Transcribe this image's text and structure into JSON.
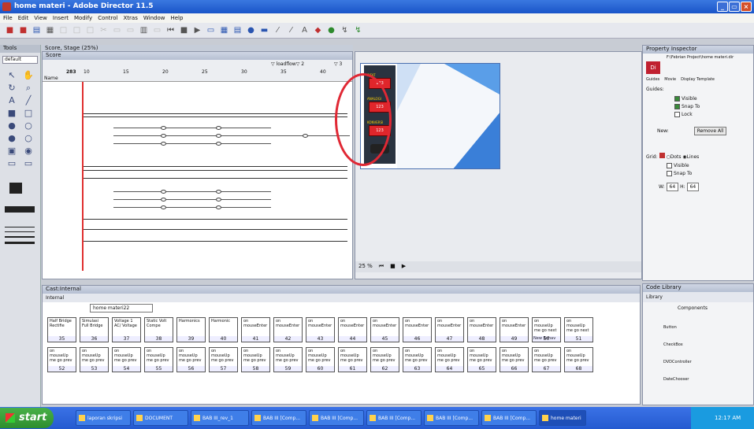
{
  "window": {
    "title": "home materi - Adobe Director 11.5",
    "buttons": [
      "_",
      "▭",
      "×"
    ]
  },
  "menu": [
    "File",
    "Edit",
    "View",
    "Insert",
    "Modify",
    "Control",
    "Xtras",
    "Window",
    "Help"
  ],
  "tools": {
    "title": "Tools",
    "mode": "default"
  },
  "score": {
    "title": "Score, Stage (25%)",
    "panel_label": "Score",
    "frame_label": "loadflow",
    "frame_num": "2",
    "frame2_label": "3",
    "channel_num": "283",
    "name_col": "Name",
    "frames": [
      "10",
      "15",
      "20",
      "25",
      "30",
      "35",
      "40"
    ]
  },
  "stage": {
    "zoom": "25 %",
    "box_labels": [
      "SIFAT",
      "ANALOGI",
      "KONVERSI"
    ],
    "box_values": [
      "123",
      "123",
      "123"
    ]
  },
  "props": {
    "title": "Property Inspector",
    "path": "F:\\Febrian Project\\home materi.dir",
    "tabs": [
      "Guides",
      "Movie",
      "Display Template"
    ],
    "guides_label": "Guides:",
    "visible": "Visible",
    "snap": "Snap To",
    "lock": "Lock",
    "new_label": "New:",
    "remove_all": "Remove All",
    "grid_label": "Grid:",
    "dots": "Dots",
    "lines": "Lines",
    "grid_visible": "Visible",
    "grid_snap": "Snap To",
    "w_label": "W:",
    "w_val": "64",
    "h_label": "H:",
    "h_val": "64"
  },
  "cast": {
    "title": "Cast:Internal",
    "tab": "Internal",
    "name_field": "home materi22",
    "row1": [
      {
        "t": "Half Bridge Rectifie",
        "n": "35"
      },
      {
        "t": "Simulasi Full Bridge",
        "n": "36"
      },
      {
        "t": "Voltage 1 AC/ Voltage",
        "n": "37"
      },
      {
        "t": "Static Volt Compe",
        "n": "38"
      },
      {
        "t": "Harmonics",
        "n": "39"
      },
      {
        "t": "Harmonic",
        "n": "40"
      },
      {
        "t": "on mouseEnter",
        "n": "41"
      },
      {
        "t": "on mouseEnter",
        "n": "42"
      },
      {
        "t": "on mouseEnter",
        "n": "43"
      },
      {
        "t": "on mouseEnter",
        "n": "44"
      },
      {
        "t": "on mouseEnter",
        "n": "45"
      },
      {
        "t": "on mouseEnter",
        "n": "46"
      },
      {
        "t": "on mouseEnter",
        "n": "47"
      },
      {
        "t": "on mouseEnter",
        "n": "48"
      },
      {
        "t": "on mouseEnter",
        "n": "49"
      },
      {
        "t": "on mouseUp me go next",
        "n": "50"
      },
      {
        "t": "on mouseUp me go next",
        "n": "51"
      }
    ],
    "row2_label": "on mouseUp me go prev",
    "row2_nums": [
      "52",
      "53",
      "54",
      "55",
      "56",
      "57",
      "58",
      "59",
      "60",
      "61",
      "62",
      "63",
      "64",
      "65",
      "66",
      "67",
      "68"
    ],
    "extra_label": "New Behav"
  },
  "codelib": {
    "title": "Code Library",
    "tab": "Library",
    "dropdown": "Components",
    "items": [
      "Button",
      "CheckBox",
      "DVDController",
      "DateChooser"
    ]
  },
  "taskbar": {
    "start": "start",
    "tasks": [
      "laporan skripsi",
      "DOCUMENT",
      "BAB III_rev_1",
      "BAB III [Comp...",
      "BAB III [Comp...",
      "BAB III [Comp...",
      "BAB III [Comp...",
      "BAB III [Comp...",
      "home materi"
    ],
    "clock": "12:17 AM"
  }
}
